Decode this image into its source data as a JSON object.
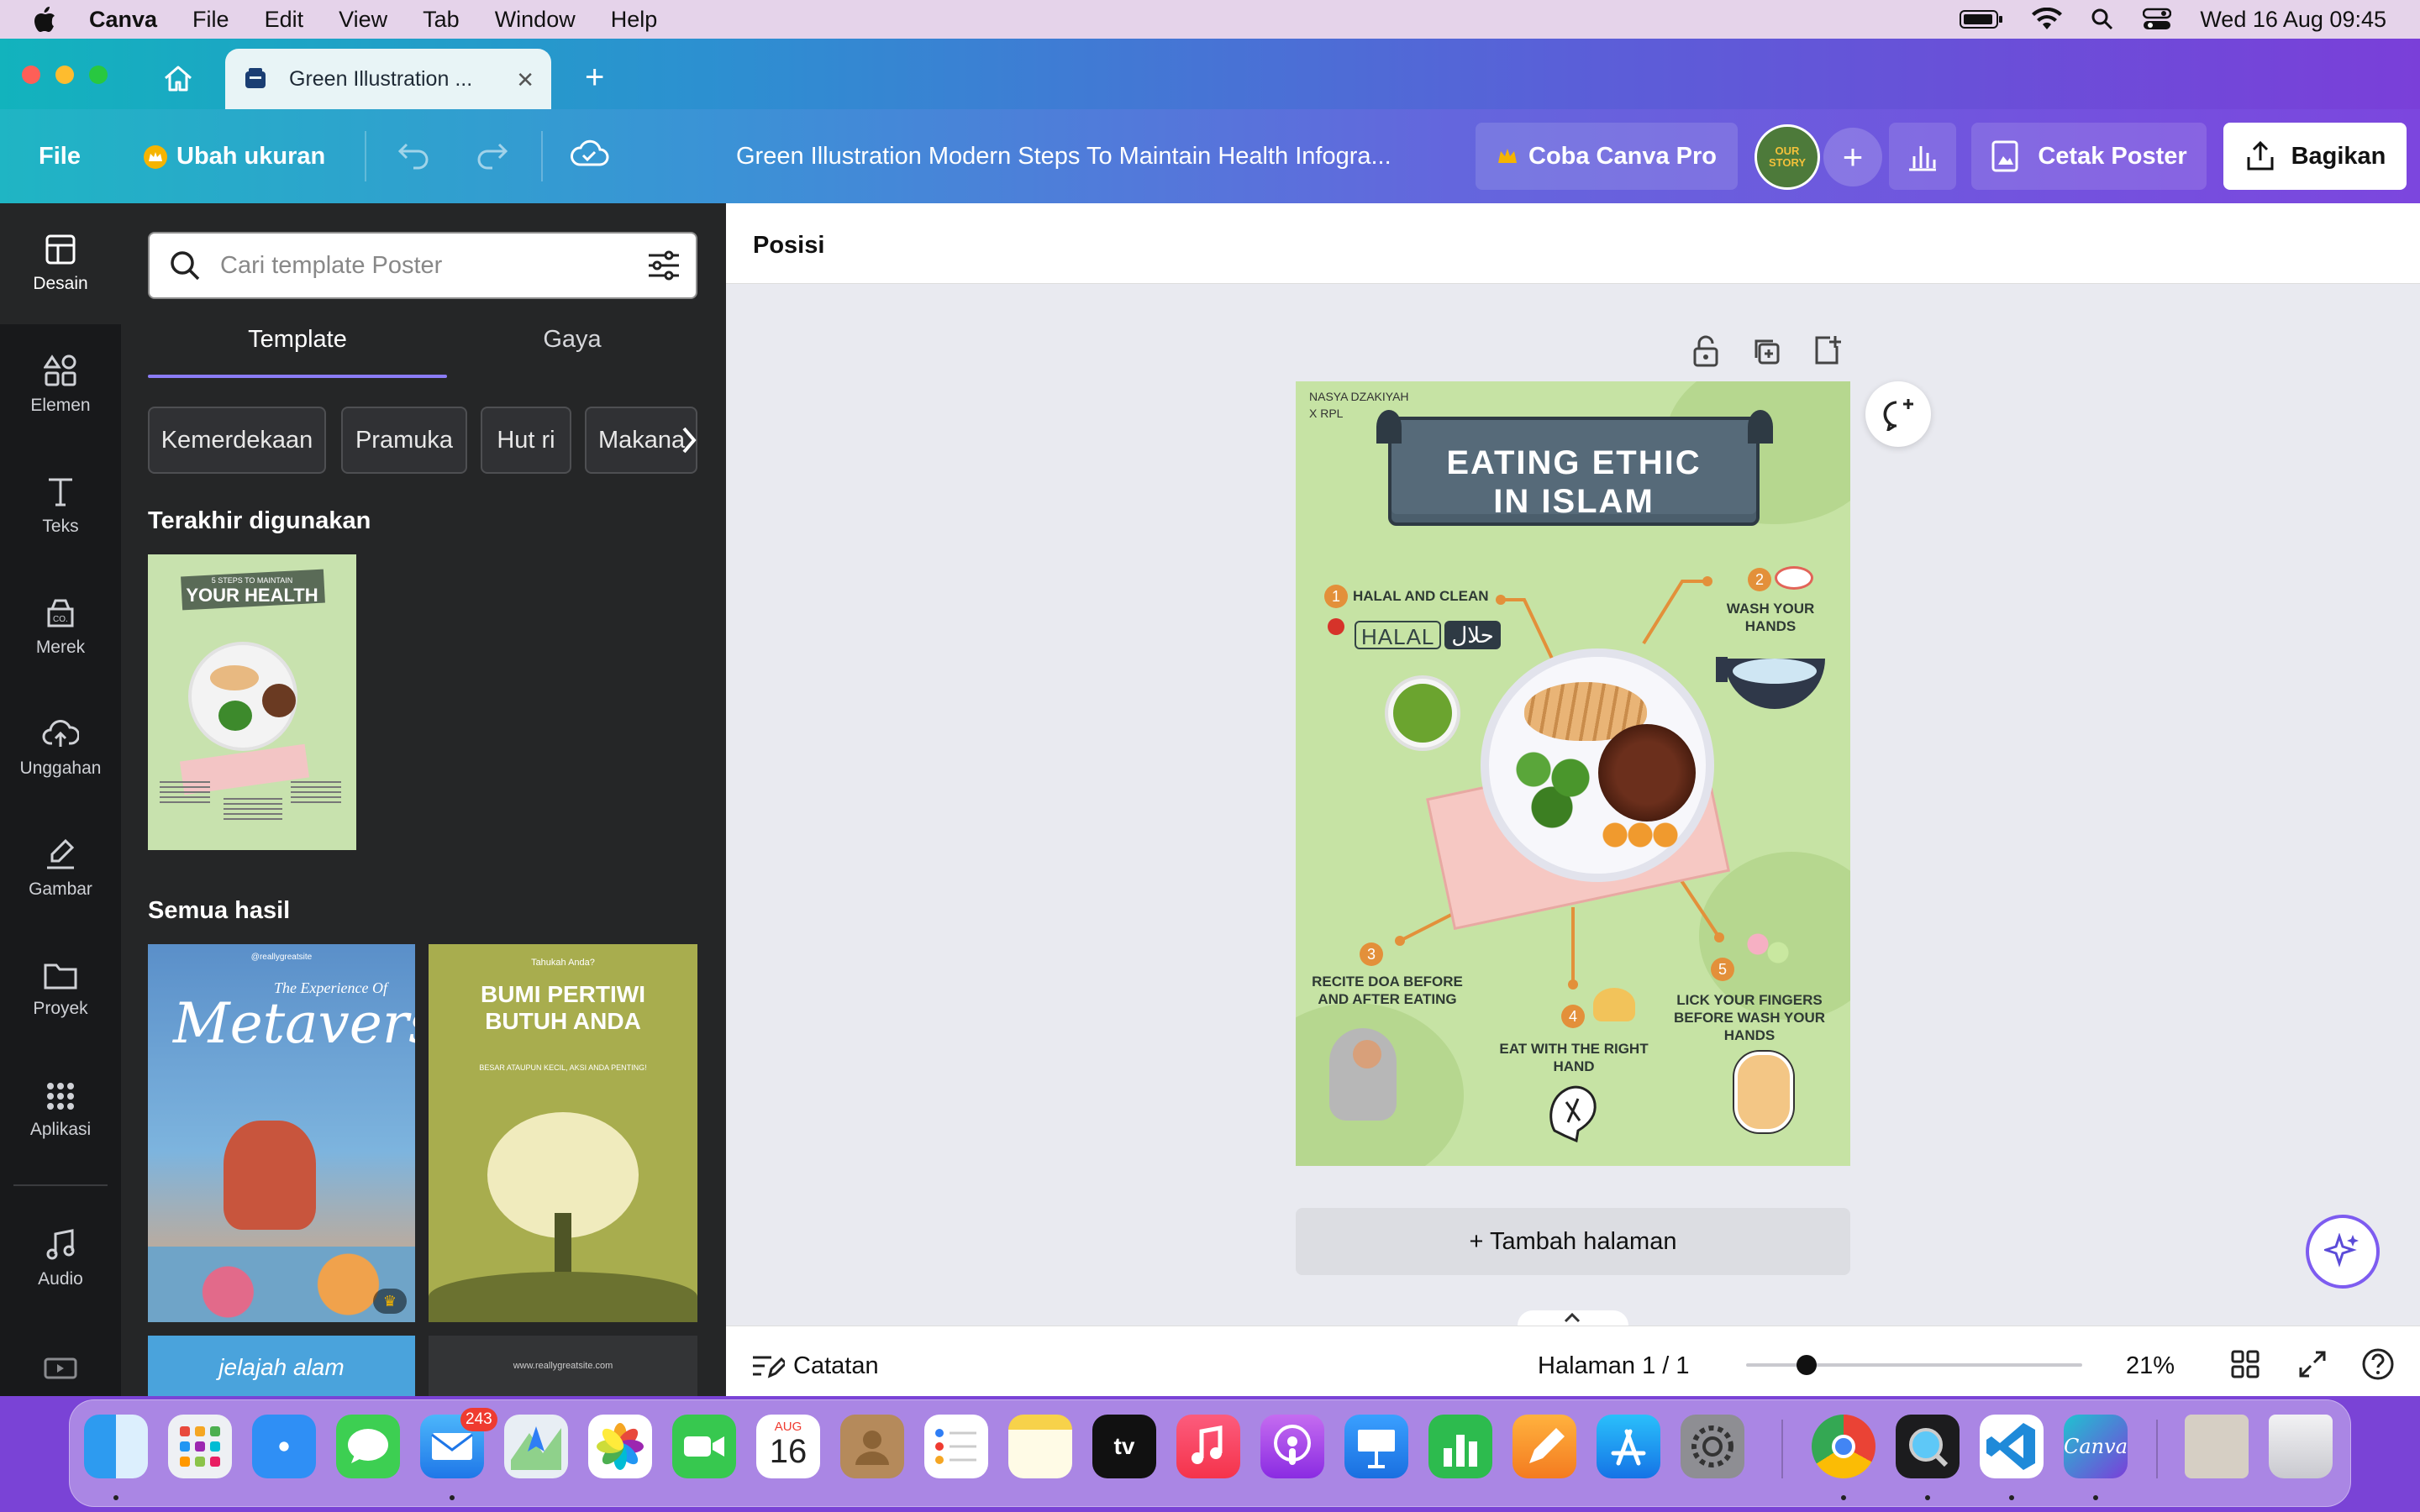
{
  "menubar": {
    "app": "Canva",
    "items": [
      "File",
      "Edit",
      "View",
      "Tab",
      "Window",
      "Help"
    ],
    "datetime": "Wed 16 Aug  09:45"
  },
  "browser": {
    "tab_title": "Green Illustration ...",
    "new_tab": "+"
  },
  "toolbar": {
    "file": "File",
    "resize": "Ubah ukuran",
    "doc_title": "Green Illustration Modern Steps To Maintain Health Infogra...",
    "try_pro": "Coba Canva Pro",
    "print": "Cetak Poster",
    "share": "Bagikan",
    "avatar_text": "OUR STORY"
  },
  "rail": [
    {
      "label": "Desain",
      "icon": "layout-icon"
    },
    {
      "label": "Elemen",
      "icon": "shapes-icon"
    },
    {
      "label": "Teks",
      "icon": "text-icon"
    },
    {
      "label": "Merek",
      "icon": "brand-icon"
    },
    {
      "label": "Unggahan",
      "icon": "upload-icon"
    },
    {
      "label": "Gambar",
      "icon": "draw-icon"
    },
    {
      "label": "Proyek",
      "icon": "folder-icon"
    },
    {
      "label": "Aplikasi",
      "icon": "apps-icon"
    },
    {
      "label": "Audio",
      "icon": "music-icon"
    }
  ],
  "panel": {
    "search_placeholder": "Cari template Poster",
    "tabs": [
      "Template",
      "Gaya"
    ],
    "chips": [
      "Kemerdekaan",
      "Pramuka",
      "Hut ri",
      "Makana"
    ],
    "recent_heading": "Terakhir digunakan",
    "all_heading": "Semua hasil",
    "recent_thumb": {
      "small": "5 STEPS TO MAINTAIN",
      "big": "YOUR HEALTH"
    },
    "results": [
      {
        "title": "Metaverse",
        "sub": "The Experience Of",
        "handle": "@reallygreatsite"
      },
      {
        "title": "BUMI PERTIWI BUTUH ANDA",
        "sub": "Tahukah Anda?",
        "tag": "BESAR ATAUPUN KECIL, AKSI ANDA PENTING!"
      },
      {
        "title": "jelajah alam"
      },
      {
        "title": "www.reallygreatsite.com"
      }
    ]
  },
  "canvas": {
    "position_label": "Posisi",
    "add_page": "+ Tambah halaman",
    "poster": {
      "author": "NASYA DZAKIYAH\nX RPL",
      "title_line1": "EATING ETHIC",
      "title_line2": "IN ISLAM",
      "halal_word": "HALAL",
      "halal_arabic": "حلال",
      "steps": [
        {
          "num": "1",
          "text": "HALAL AND CLEAN"
        },
        {
          "num": "2",
          "text": "WASH YOUR HANDS"
        },
        {
          "num": "3",
          "text": "RECITE DOA BEFORE AND AFTER EATING"
        },
        {
          "num": "4",
          "text": "EAT WITH THE RIGHT HAND"
        },
        {
          "num": "5",
          "text": "LICK YOUR FINGERS BEFORE WASH YOUR HANDS"
        }
      ]
    }
  },
  "bottombar": {
    "notes": "Catatan",
    "page": "Halaman 1 / 1",
    "zoom": "21%",
    "zoom_fraction": 0.18
  },
  "dock": {
    "mail_badge": "243",
    "calendar_month": "AUG",
    "calendar_day": "16",
    "canva_label": "Canva"
  },
  "colors": {
    "poster_bg": "#c6e3a4",
    "ribbon": "#566a79",
    "accent_orange": "#e3903a",
    "panel_bg": "#252627"
  }
}
